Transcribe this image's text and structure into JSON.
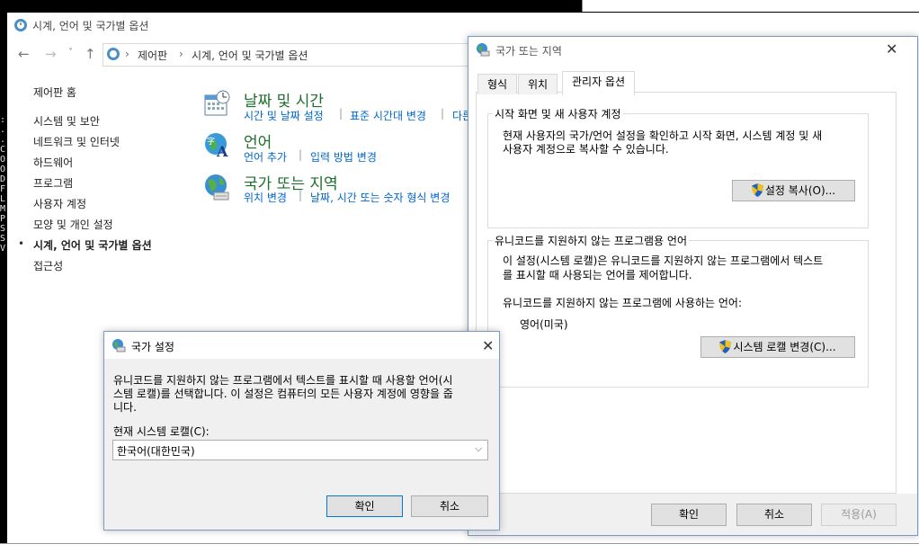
{
  "control_panel": {
    "window_title": "시계, 언어 및 국가별 옵션",
    "breadcrumb": [
      "제어판",
      "시계, 언어 및 국가별 옵션"
    ],
    "sidebar": [
      "제어판 홈",
      "시스템 및 보안",
      "네트워크 및 인터넷",
      "하드웨어",
      "프로그램",
      "사용자 계정",
      "모양 및 개인 설정",
      "시계, 언어 및 국가별 옵션",
      "접근성"
    ],
    "categories": [
      {
        "title": "날짜 및 시간",
        "links": [
          "시간 및 날짜 설정",
          "표준 시간대 변경",
          "다른"
        ]
      },
      {
        "title": "언어",
        "links": [
          "언어 추가",
          "입력 방법 변경"
        ]
      },
      {
        "title": "국가 또는 지역",
        "links": [
          "위치 변경",
          "날짜, 시간 또는 숫자 형식 변경"
        ]
      }
    ]
  },
  "region_dialog": {
    "title": "국가 또는 지역",
    "tabs": [
      "형식",
      "위치",
      "관리자 옵션"
    ],
    "group1": {
      "label": "시작 화면 및 새 사용자 계정",
      "text_line1": "현재 사용자의 국가/언어 설정을 확인하고 시작 화면, 시스템 계정 및 새",
      "text_line2": "사용자 계정으로 복사할 수 있습니다.",
      "button": "설정 복사(O)..."
    },
    "group2": {
      "label": "유니코드를 지원하지 않는 프로그램용 언어",
      "text_line1": "이 설정(시스템 로캘)은 유니코드를 지원하지 않는 프로그램에서 텍스트",
      "text_line2": "를 표시할 때 사용되는 언어를 제어합니다.",
      "current_label": "유니코드를 지원하지 않는 프로그램에 사용하는 언어:",
      "current_value": "영어(미국)",
      "button": "시스템 로캘 변경(C)..."
    },
    "buttons": {
      "ok": "확인",
      "cancel": "취소",
      "apply": "적용(A)"
    }
  },
  "locale_dialog": {
    "title": "국가 설정",
    "text_line1": "유니코드를 지원하지 않는 프로그램에서 텍스트를 표시할 때 사용할 언어(시",
    "text_line2": "스템 로캘)를 선택합니다. 이 설정은 컴퓨터의 모든 사용자 계정에 영향을 줍",
    "text_line3": "니다.",
    "field_label": "현재 시스템 로캘(C):",
    "field_value": "한국어(대한민국)",
    "buttons": {
      "ok": "확인",
      "cancel": "취소"
    }
  },
  "background_chars": [
    ":",
    ".",
    ".",
    "C",
    "O",
    "O",
    "D",
    "F",
    "L",
    "M",
    "P",
    "S",
    "S",
    "V"
  ],
  "colors": {
    "accent": "#0078d7",
    "link": "#0066cc",
    "category_title": "#1e6e2e"
  }
}
